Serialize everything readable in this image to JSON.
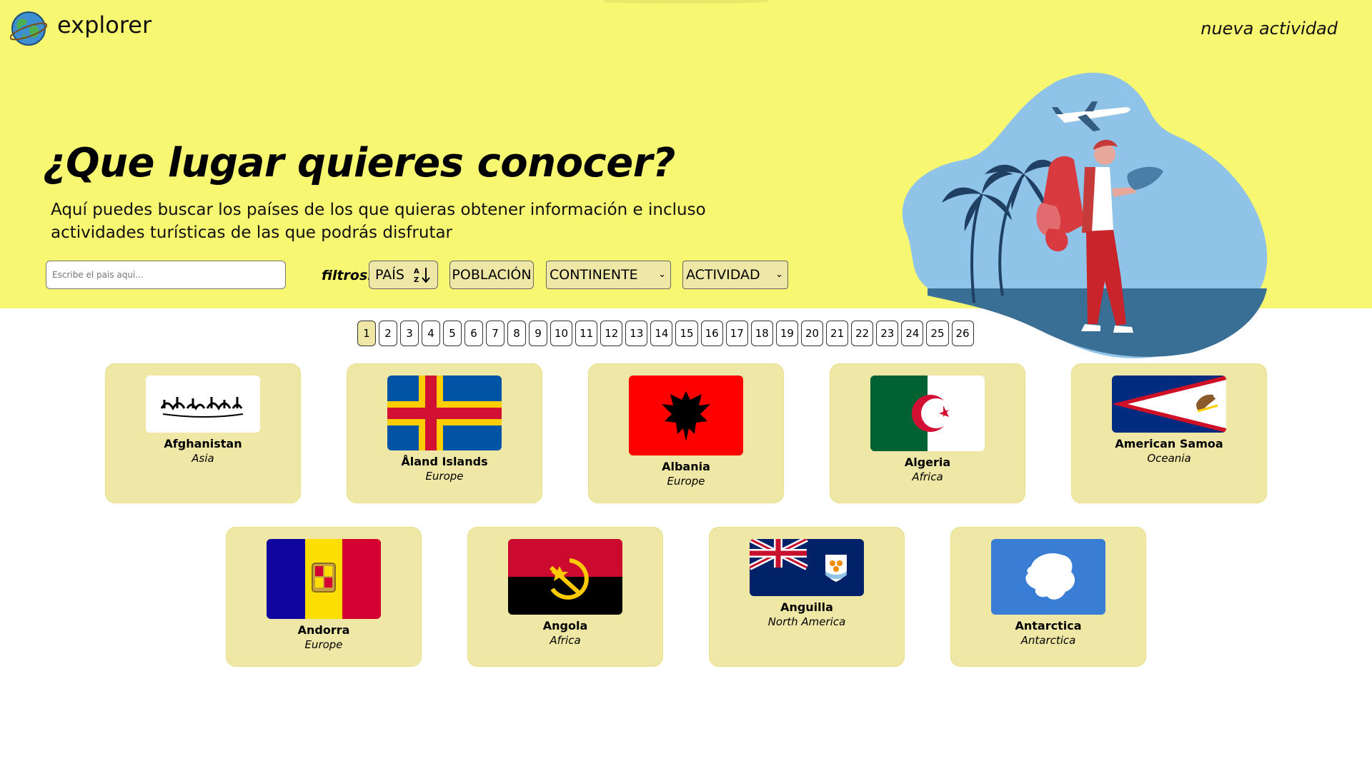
{
  "header": {
    "brand": "explorer",
    "new_activity": "nueva actividad"
  },
  "hero": {
    "title": "¿Que lugar quieres conocer?",
    "subtitle": "Aquí puedes buscar los países de los que quieras obtener información e incluso actividades turísticas de las que podrás disfrutar"
  },
  "search": {
    "placeholder": "Escribe el pais aqui..."
  },
  "filters": {
    "label": "filtros:",
    "country": "PAÍS",
    "sort_icon": "sort-az-icon",
    "population": "POBLACIÓN",
    "continent": "CONTINENTE",
    "activity": "ACTIVIDAD"
  },
  "pagination": {
    "current": "1",
    "pages": [
      "1",
      "2",
      "3",
      "4",
      "5",
      "6",
      "7",
      "8",
      "9",
      "10",
      "11",
      "12",
      "13",
      "14",
      "15",
      "16",
      "17",
      "18",
      "19",
      "20",
      "21",
      "22",
      "23",
      "24",
      "25",
      "26"
    ]
  },
  "countries": [
    {
      "name": "Afghanistan",
      "continent": "Asia",
      "flag": "afghanistan-flag"
    },
    {
      "name": "Åland Islands",
      "continent": "Europe",
      "flag": "aland-flag"
    },
    {
      "name": "Albania",
      "continent": "Europe",
      "flag": "albania-flag"
    },
    {
      "name": "Algeria",
      "continent": "Africa",
      "flag": "algeria-flag"
    },
    {
      "name": "American Samoa",
      "continent": "Oceania",
      "flag": "american-samoa-flag"
    },
    {
      "name": "Andorra",
      "continent": "Europe",
      "flag": "andorra-flag"
    },
    {
      "name": "Angola",
      "continent": "Africa",
      "flag": "angola-flag"
    },
    {
      "name": "Anguilla",
      "continent": "North America",
      "flag": "anguilla-flag"
    },
    {
      "name": "Antarctica",
      "continent": "Antarctica",
      "flag": "antarctica-flag"
    }
  ],
  "colors": {
    "hero_bg": "#f8f772",
    "card_bg": "#efe7a5",
    "accent_blue": "#8fc3e8"
  }
}
